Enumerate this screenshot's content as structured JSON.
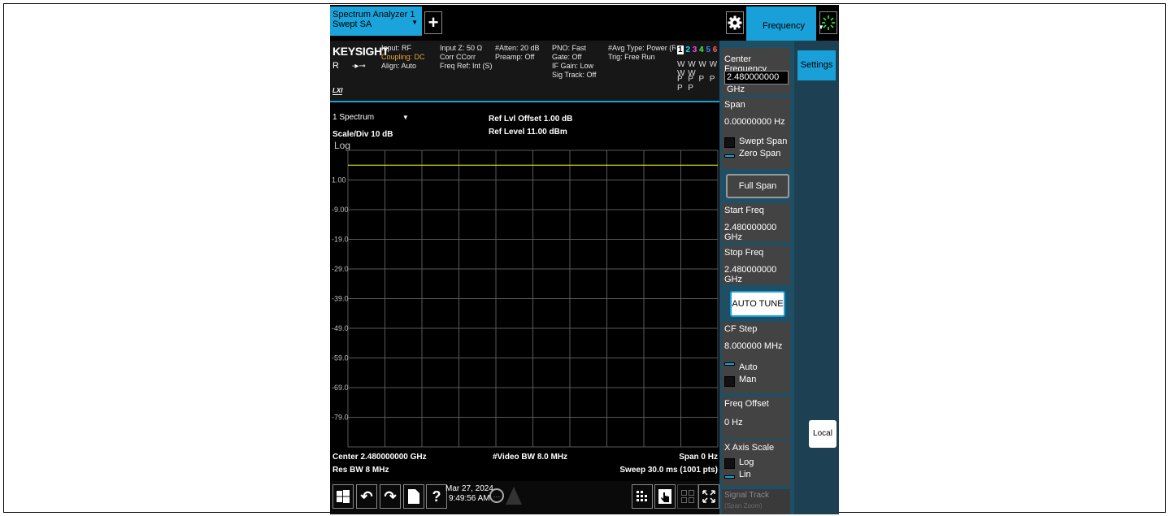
{
  "tabs": {
    "main_line1": "Spectrum Analyzer 1",
    "main_line2": "Swept SA",
    "add": "+"
  },
  "menu": {
    "label": "Frequency"
  },
  "status": {
    "brand": "KEYSIGHT",
    "r": "R",
    "lxi": "LXI",
    "col1": [
      "Input: RF",
      "Coupling: DC",
      "Align: Auto"
    ],
    "col2": [
      "Input Z: 50 Ω",
      "Corr CCorr",
      "Freq Ref: Int (S)"
    ],
    "col3": [
      "#Atten: 20 dB",
      "Preamp: Off"
    ],
    "col4": [
      "PNO: Fast",
      "Gate: Off",
      "IF Gain: Low",
      "Sig Track: Off"
    ],
    "col5": [
      "#Avg Type: Power (RMS)",
      "Trig: Free Run"
    ],
    "traces": [
      "1",
      "2",
      "3",
      "4",
      "5",
      "6"
    ],
    "trace_colors": [
      "#ffff00",
      "#00e0ff",
      "#ff40ff",
      "#40ff40",
      "#4080ff",
      "#ff6060"
    ],
    "trace_types": "W W W W W W",
    "trace_dets": "P P P P P P"
  },
  "plot": {
    "window": "1 Spectrum",
    "scale": "Scale/Div 10 dB",
    "log": "Log",
    "ref_offset": "Ref Lvl Offset 1.00 dB",
    "ref_level": "Ref Level 11.00 dBm",
    "y_ticks": [
      "1.00",
      "-9.00",
      "-19.0",
      "-29.0",
      "-39.0",
      "-49.0",
      "-59.0",
      "-69.0",
      "-79.0"
    ],
    "trace_color": "#ffff00",
    "center": "Center 2.480000000 GHz",
    "res_bw": "Res BW 8 MHz",
    "video_bw": "#Video BW 8.0 MHz",
    "span": "Span 0 Hz",
    "sweep": "Sweep 30.0 ms (1001 pts)"
  },
  "taskbar": {
    "date": "Mar 27, 2024",
    "time": "9:49:56 AM",
    "help": "?"
  },
  "panel": {
    "center_freq_label": "Center Frequency",
    "center_freq_value": "2.480000000 GHz",
    "span_label": "Span",
    "span_value": "0.00000000 Hz",
    "swept_span": "Swept Span",
    "zero_span": "Zero Span",
    "full_span": "Full Span",
    "start_freq_label": "Start Freq",
    "start_freq_value": "2.480000000 GHz",
    "stop_freq_label": "Stop Freq",
    "stop_freq_value": "2.480000000 GHz",
    "auto_tune": "AUTO TUNE",
    "cf_step_label": "CF Step",
    "cf_step_value": "8.000000 MHz",
    "auto": "Auto",
    "man": "Man",
    "freq_offset_label": "Freq Offset",
    "freq_offset_value": "0 Hz",
    "x_axis_label": "X Axis Scale",
    "log": "Log",
    "lin": "Lin",
    "signal_track": "Signal Track",
    "span_zoom": "(Span Zoom)"
  },
  "rtabs": {
    "settings": "Settings",
    "local": "Local"
  },
  "colors": {
    "accent": "#1aa0d8",
    "panel_bg": "#1e4f64",
    "key_bg": "#434343"
  }
}
